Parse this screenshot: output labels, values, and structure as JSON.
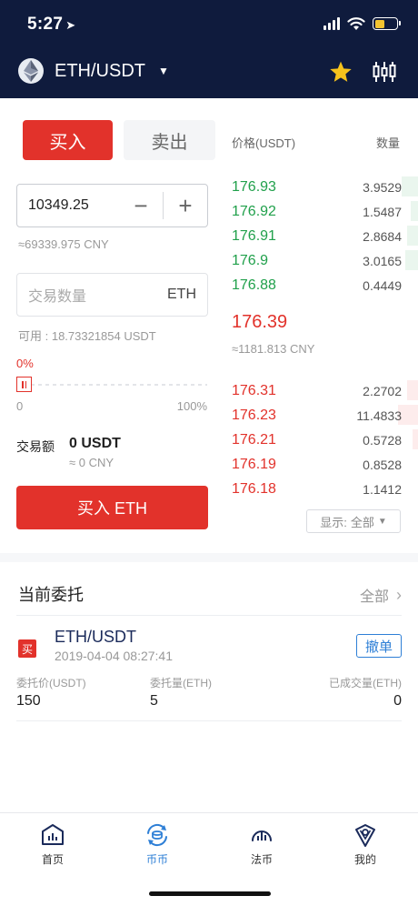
{
  "status": {
    "time": "5:27"
  },
  "header": {
    "pair": "ETH/USDT"
  },
  "trade": {
    "buy_tab": "买入",
    "sell_tab": "卖出",
    "price_value": "10349.25",
    "price_cny": "≈69339.975 CNY",
    "qty_placeholder": "交易数量",
    "qty_unit": "ETH",
    "available": "可用 : 18.73321854 USDT",
    "percent": "0%",
    "slider_min": "0",
    "slider_max": "100%",
    "slider_value": 0,
    "amount_label": "交易额",
    "amount_value": "0 USDT",
    "amount_cny": "≈ 0 CNY",
    "submit_label": "买入 ETH"
  },
  "orderbook": {
    "price_header": "价格(USDT)",
    "qty_header": "数量",
    "bids": [
      {
        "price": "176.93",
        "qty": "3.9529"
      },
      {
        "price": "176.92",
        "qty": "1.5487"
      },
      {
        "price": "176.91",
        "qty": "2.8684"
      },
      {
        "price": "176.9",
        "qty": "3.0165"
      },
      {
        "price": "176.88",
        "qty": "0.4449"
      }
    ],
    "last_price": "176.39",
    "last_cny": "≈1181.813 CNY",
    "asks": [
      {
        "price": "176.31",
        "qty": "2.2702"
      },
      {
        "price": "176.23",
        "qty": "11.4833"
      },
      {
        "price": "176.21",
        "qty": "0.5728"
      },
      {
        "price": "176.19",
        "qty": "0.8528"
      },
      {
        "price": "176.18",
        "qty": "1.1412"
      }
    ],
    "display_label": "显示:",
    "display_value": "全部"
  },
  "orders": {
    "title": "当前委托",
    "all_label": "全部",
    "items": [
      {
        "badge": "买",
        "pair": "ETH/USDT",
        "time": "2019-04-04 08:27:41",
        "cancel_label": "撤单",
        "price_label": "委托价(USDT)",
        "price_value": "150",
        "amount_label": "委托量(ETH)",
        "amount_value": "5",
        "filled_label": "已成交量(ETH)",
        "filled_value": "0"
      }
    ]
  },
  "nav": {
    "items": [
      {
        "label": "首页",
        "icon": "home-chart-icon"
      },
      {
        "label": "币币",
        "icon": "coin-exchange-icon"
      },
      {
        "label": "法币",
        "icon": "fiat-gauge-icon"
      },
      {
        "label": "我的",
        "icon": "profile-shield-icon"
      }
    ],
    "active": "币币"
  },
  "colors": {
    "header_bg": "#0f1b3d",
    "buy_red": "#e2322b",
    "bid_green": "#20a04b",
    "link_blue": "#2e7fd6",
    "star_yellow": "#f6c21c"
  }
}
